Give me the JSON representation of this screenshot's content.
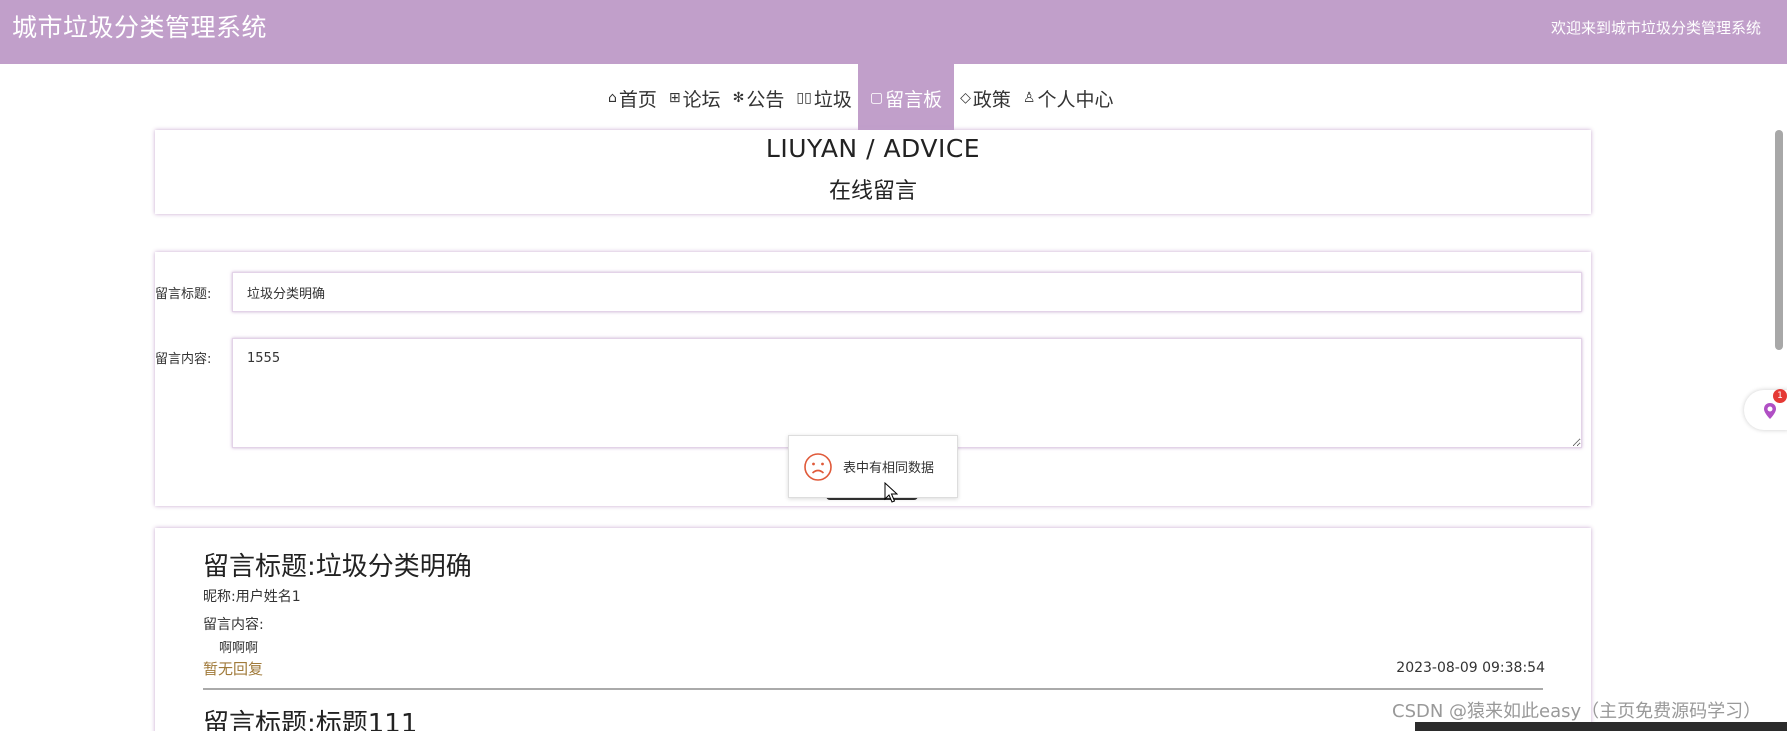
{
  "app": {
    "title": "城市垃圾分类管理系统",
    "welcome": "欢迎来到城市垃圾分类管理系统",
    "accent_color": "#c19fca"
  },
  "nav": {
    "items": [
      {
        "label": "首页",
        "icon": "home-icon",
        "glyph": "⌂"
      },
      {
        "label": "论坛",
        "icon": "book-icon",
        "glyph": "⊞"
      },
      {
        "label": "公告",
        "icon": "snowflake-icon",
        "glyph": "✻"
      },
      {
        "label": "垃圾",
        "icon": "columns-icon",
        "glyph": "▯▯"
      },
      {
        "label": "留言板",
        "icon": "document-icon",
        "glyph": "▢",
        "active": true
      },
      {
        "label": "政策",
        "icon": "tag-icon",
        "glyph": "◇"
      },
      {
        "label": "个人中心",
        "icon": "user-icon",
        "glyph": "♙"
      }
    ]
  },
  "header": {
    "en": "LIUYAN / ADVICE",
    "cn": "在线留言"
  },
  "form": {
    "title_label": "留言标题:",
    "title_value": "垃圾分类明确",
    "content_label": "留言内容:",
    "content_value": "1555"
  },
  "toast": {
    "message": "表中有相同数据",
    "icon": "sad-face-icon"
  },
  "messages": [
    {
      "title": "留言标题:垃圾分类明确",
      "nickname": "昵称:用户姓名1",
      "content_label": "留言内容:",
      "content": "啊啊啊",
      "reply": "暂无回复",
      "time": "2023-08-09 09:38:54"
    },
    {
      "title": "留言标题:标题111"
    }
  ],
  "side_widget": {
    "badge": "1"
  },
  "watermark": "CSDN @猿来如此easy（主页免费源码学习）"
}
